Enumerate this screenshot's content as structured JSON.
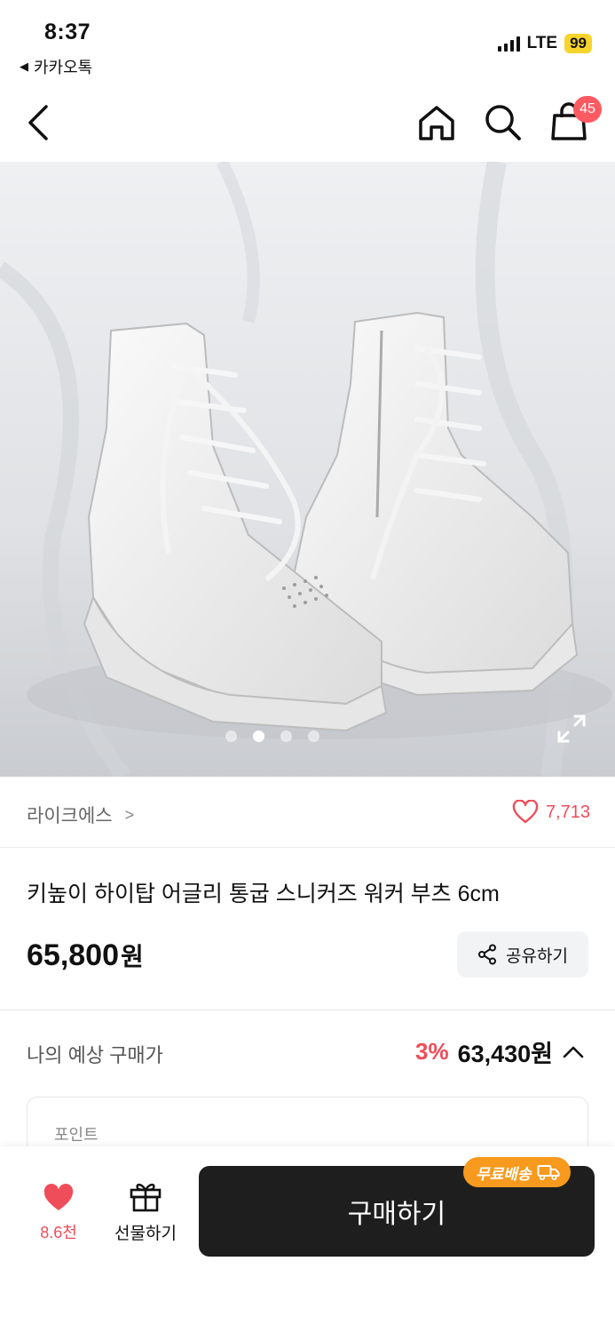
{
  "status_bar": {
    "time": "8:37",
    "back_app": "카카오톡",
    "network": "LTE",
    "battery": "99"
  },
  "nav": {
    "cart_count": "45"
  },
  "gallery": {
    "dot_count": 4,
    "active_dot": 2
  },
  "store": {
    "name": "라이크에스",
    "likes": "7,713"
  },
  "product": {
    "title": "키높이 하이탑 어글리 통굽 스니커즈 워커 부츠 6cm",
    "price": "65,800",
    "currency": "원",
    "share_label": "공유하기"
  },
  "estimate": {
    "label": "나의 예상 구매가",
    "discount": "3%",
    "price": "63,430원"
  },
  "points": {
    "label": "포인트"
  },
  "bottom": {
    "wish_count": "8.6천",
    "gift_label": "선물하기",
    "buy_label": "구매하기",
    "free_shipping": "무료배송"
  },
  "colors": {
    "accent_red": "#ef4d5a",
    "badge_orange": "#f79a1e",
    "buy_button": "#1e1e1e"
  }
}
